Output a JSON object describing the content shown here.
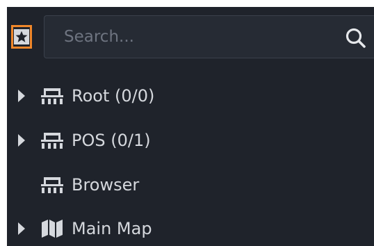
{
  "search": {
    "placeholder": "Search..."
  },
  "tree": {
    "items": [
      {
        "label": "Root (0/0)",
        "icon": "organization-icon",
        "expandable": true
      },
      {
        "label": "POS (0/1)",
        "icon": "organization-icon",
        "expandable": true
      },
      {
        "label": "Browser",
        "icon": "organization-icon",
        "expandable": false
      },
      {
        "label": "Main Map",
        "icon": "map-icon",
        "expandable": true
      }
    ]
  },
  "colors": {
    "panel_background": "#1f232b",
    "search_background": "#262b34",
    "accent_orange": "#f0872a",
    "text": "#d5d8dd",
    "placeholder": "#6e7480"
  }
}
